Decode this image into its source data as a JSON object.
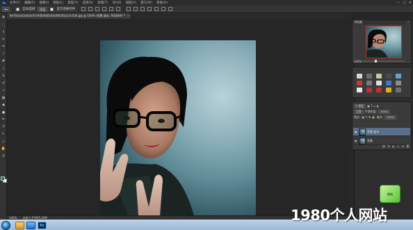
{
  "app": {
    "logo": "Ps"
  },
  "menubar": {
    "items": [
      "文件(F)",
      "编辑(E)",
      "图像(I)",
      "图层(L)",
      "类型(Y)",
      "选择(S)",
      "滤镜(T)",
      "3D(D)",
      "视图(V)",
      "窗口(W)",
      "帮助(H)"
    ],
    "window_controls": [
      "—",
      "□",
      "✕"
    ]
  },
  "options_bar": {
    "auto_select_label": "自动选择",
    "auto_select_target": "图层",
    "show_transform_label": "显示变换控件"
  },
  "document_tab": {
    "title": "9e70a2a1beb5a47c9d5d0bfa56a69cf0a2c5c5d4.jpg @ 100% (背景 副本, RGB/8#) *",
    "close": "×"
  },
  "tools": [
    {
      "icon": "move-tool-icon",
      "glyph": "✥"
    },
    {
      "icon": "marquee-tool-icon",
      "glyph": "⬚"
    },
    {
      "icon": "lasso-tool-icon",
      "glyph": "ʖ"
    },
    {
      "icon": "quick-select-icon",
      "glyph": "✎"
    },
    {
      "icon": "crop-tool-icon",
      "glyph": "⌗"
    },
    {
      "icon": "eyedropper-icon",
      "glyph": "⁄"
    },
    {
      "icon": "healing-brush-icon",
      "glyph": "✚"
    },
    {
      "icon": "brush-tool-icon",
      "glyph": "∕"
    },
    {
      "icon": "clone-stamp-icon",
      "glyph": "♙"
    },
    {
      "icon": "history-brush-icon",
      "glyph": "↺"
    },
    {
      "icon": "eraser-tool-icon",
      "glyph": "▱"
    },
    {
      "icon": "gradient-tool-icon",
      "glyph": "▦"
    },
    {
      "icon": "blur-tool-icon",
      "glyph": "◆"
    },
    {
      "icon": "dodge-tool-icon",
      "glyph": "●"
    },
    {
      "icon": "pen-tool-icon",
      "glyph": "✒"
    },
    {
      "icon": "type-tool-icon",
      "glyph": "T"
    },
    {
      "icon": "path-select-icon",
      "glyph": "↖"
    },
    {
      "icon": "shape-tool-icon",
      "glyph": "▭"
    },
    {
      "icon": "hand-tool-icon",
      "glyph": "✋"
    },
    {
      "icon": "zoom-tool-icon",
      "glyph": "⚲"
    }
  ],
  "colors": {
    "foreground": "#1e6a8a",
    "background": "#ffffff",
    "accent": "#5a6f8a"
  },
  "navigator": {
    "title": "导航器",
    "zoom": "100%"
  },
  "adjustments": {
    "icons": [
      {
        "name": "brightness-icon",
        "color": "#d8d8d8"
      },
      {
        "name": "levels-icon",
        "color": "#6a6a6a"
      },
      {
        "name": "curves-icon",
        "color": "#c9c9a0"
      },
      {
        "name": "exposure-icon",
        "color": "#4a4a4a"
      },
      {
        "name": "vibrance-icon",
        "color": "#6aa0d0"
      },
      {
        "name": "hue-sat-icon",
        "color": "#c0402a"
      },
      {
        "name": "color-balance-icon",
        "color": "#7a7a7a"
      },
      {
        "name": "bw-icon",
        "color": "#e0e0e0"
      },
      {
        "name": "photo-filter-icon",
        "color": "#3a7ad0"
      },
      {
        "name": "channel-mixer-icon",
        "color": "#8c8c8c"
      },
      {
        "name": "invert-icon",
        "color": "#e8e8e8"
      },
      {
        "name": "posterize-icon",
        "color": "#c03030"
      },
      {
        "name": "threshold-icon",
        "color": "#c03030"
      },
      {
        "name": "gradient-map-icon",
        "color": "#e0b020"
      },
      {
        "name": "selective-color-icon",
        "color": "#707070"
      }
    ]
  },
  "layers": {
    "kind_filter": "P 类型",
    "blend_mode": "正常",
    "opacity_label": "不透明度:",
    "opacity_value": "100%",
    "lock_label": "锁定:",
    "fill_label": "填充:",
    "fill_value": "100%",
    "items": [
      {
        "name": "背景 副本",
        "selected": true
      },
      {
        "name": "背景",
        "selected": false
      }
    ],
    "footer_icons": [
      "⛓",
      "fx",
      "◐",
      "▭",
      "⊞",
      "🗑"
    ]
  },
  "status": {
    "zoom": "100%",
    "doc": "文档:1.07M/5.40M"
  },
  "watermark": {
    "text": "1980个人网站"
  },
  "watermark_logo": {
    "text": "网站"
  }
}
